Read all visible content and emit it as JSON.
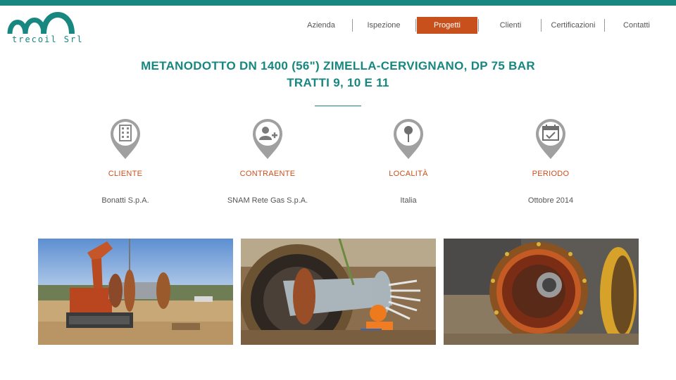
{
  "brand": {
    "name": "trecoil Srl",
    "color": "#17877f",
    "accent": "#c8501c"
  },
  "nav": {
    "items": [
      {
        "label": "Azienda",
        "active": false
      },
      {
        "label": "Ispezione",
        "active": false
      },
      {
        "label": "Progetti",
        "active": true
      },
      {
        "label": "Clienti",
        "active": false
      },
      {
        "label": "Certificazioni",
        "active": false
      },
      {
        "label": "Contatti",
        "active": false
      }
    ]
  },
  "project": {
    "title_line1": "METANODOTTO DN 1400 (56\") ZIMELLA-CERVIGNANO, DP 75 BAR",
    "title_line2": "TRATTI 9, 10 E 11"
  },
  "info": [
    {
      "label": "CLIENTE",
      "value": "Bonatti S.p.A.",
      "icon": "building-icon"
    },
    {
      "label": "CONTRAENTE",
      "value": "SNAM Rete Gas S.p.A.",
      "icon": "user-add-icon"
    },
    {
      "label": "LOCALITÀ",
      "value": "Italia",
      "icon": "map-pin-icon"
    },
    {
      "label": "PERIODO",
      "value": "Ottobre 2014",
      "icon": "calendar-icon"
    }
  ],
  "gallery": {
    "images": [
      {
        "icon": "excavator-photo"
      },
      {
        "icon": "pipe-interior-photo"
      },
      {
        "icon": "pipe-end-photo"
      }
    ]
  }
}
